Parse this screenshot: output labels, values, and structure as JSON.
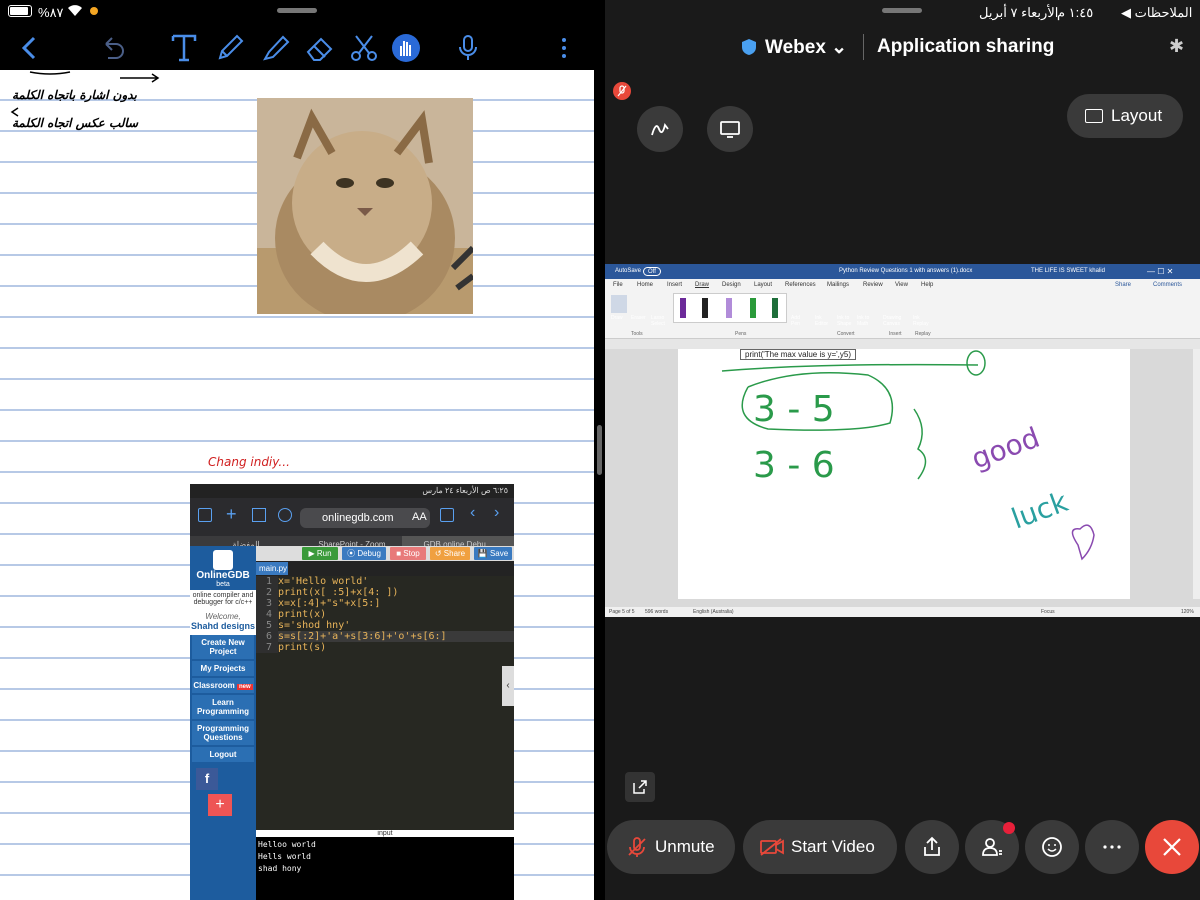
{
  "left_status": {
    "battery": "%٨٧"
  },
  "notes": {
    "handwriting_top1": "بدون اشارة باتجاه الكلمة",
    "handwriting_top2": "سالب عكس اتجاه الكلمة",
    "handwriting_mid": "Chang indiy..."
  },
  "gdb_screenshot": {
    "status": "٦:٢٥ ص  الأربعاء ٢٤ مارس",
    "url": "onlinegdb.com",
    "url_prefix": "AA",
    "tabs": [
      "المفضلة",
      "SharePoint - Zoom",
      "GDB online Debu..."
    ],
    "logo": "OnlineGDB",
    "logo_sub": "beta",
    "tagline": "online compiler and debugger for c/c++",
    "welcome": "Welcome,",
    "username": "Shahd designs",
    "side_items": [
      "Create New Project",
      "My Projects",
      "Classroom",
      "Learn Programming",
      "Programming Questions",
      "Logout"
    ],
    "classroom_badge": "new",
    "buttons": [
      "Run",
      "Debug",
      "Stop",
      "Share",
      "Save"
    ],
    "file_tab": "main.py",
    "code_lines": [
      "x='Hello world'",
      "print(x[ :5]+x[4: ])",
      "x=x[:4]+\"s\"+x[5:]",
      "print(x)",
      "s='shod hny'",
      "s=s[:2]+'a'+s[3:6]+'o'+s[6:]",
      "print(s)"
    ],
    "input_label": "input",
    "output_lines": [
      "Helloo world",
      "Hells world",
      "shad hony"
    ]
  },
  "right_status": {
    "app": "الملاحظات",
    "time": "١:٤٥ م",
    "date": "الأربعاء ٧ أبريل"
  },
  "webex": {
    "brand": "Webex",
    "title": "Application sharing",
    "layout_label": "Layout",
    "unmute_label": "Unmute",
    "video_label": "Start Video"
  },
  "word": {
    "autosave": "AutoSave",
    "autosave_state": "Off",
    "doc_title": "Python Review Questions 1 with answers (1).docx",
    "user": "THE LIFE IS SWEET khalid",
    "menu": [
      "File",
      "Home",
      "Insert",
      "Draw",
      "Design",
      "Layout",
      "References",
      "Mailings",
      "Review",
      "View",
      "Help"
    ],
    "share": "Share",
    "comments": "Comments",
    "ribbon_groups": [
      "Tools",
      "Pens",
      "Convert",
      "Insert",
      "Replay"
    ],
    "ribbon_buttons": [
      "Draw",
      "Eraser",
      "Lasso Select",
      "Add Pen",
      "Ink Editor",
      "Ink to Shape",
      "Ink to Math",
      "Drawing Canvas",
      "Ink Replay"
    ],
    "page_text": "print('The max value is y=',y5)",
    "ink_text1": "good",
    "ink_text2": "luck",
    "status_page": "Page 5 of 5",
    "status_words": "596 words",
    "status_lang": "English (Australia)",
    "status_focus": "Focus",
    "zoom": "120%"
  }
}
